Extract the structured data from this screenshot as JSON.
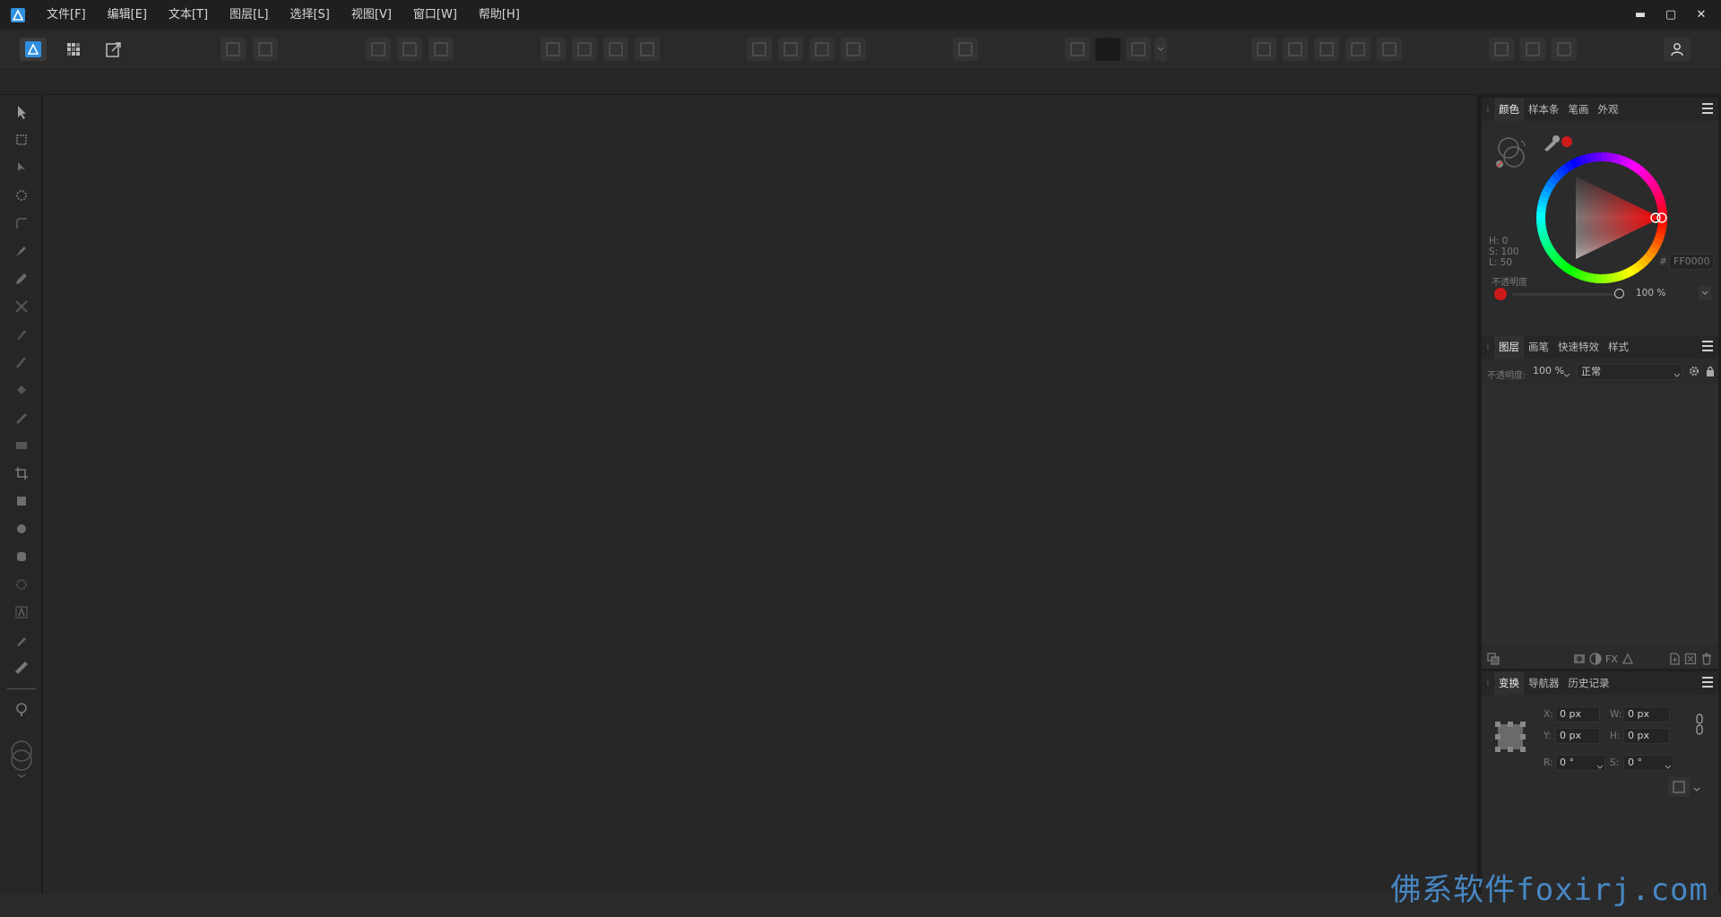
{
  "menu": {
    "items": [
      "文件[F]",
      "编辑[E]",
      "文本[T]",
      "图层[L]",
      "选择[S]",
      "视图[V]",
      "窗口[W]",
      "帮助[H]"
    ]
  },
  "window_controls": {
    "minimize": "▬",
    "maximize": "▢",
    "close": "✕"
  },
  "colors": {
    "accent": "#4aa3ff",
    "current_color": "#ff0000"
  },
  "color_panel": {
    "tabs": [
      "颜色",
      "样本条",
      "笔画",
      "外观"
    ],
    "active_tab": "颜色",
    "h": "H: 0",
    "s": "S: 100",
    "l": "L: 50",
    "hex": "FF0000",
    "hash": "#",
    "opacity_label": "不透明度",
    "opacity_value": "100 %"
  },
  "layers_panel": {
    "tabs": [
      "图层",
      "画笔",
      "快速特效",
      "样式"
    ],
    "active_tab": "图层",
    "opacity_label": "不透明度:",
    "opacity_value": "100 %",
    "blend_mode": "正常"
  },
  "transform_panel": {
    "tabs": [
      "变换",
      "导航器",
      "历史记录"
    ],
    "active_tab": "变换",
    "x_label": "X:",
    "x_value": "0 px",
    "y_label": "Y:",
    "y_value": "0 px",
    "w_label": "W:",
    "w_value": "0 px",
    "h_label": "H:",
    "h_value": "0 px",
    "r_label": "R:",
    "r_value": "0 °",
    "s_label": "S:",
    "s_value": "0 °"
  },
  "watermark": "佛系软件foxirj.com"
}
